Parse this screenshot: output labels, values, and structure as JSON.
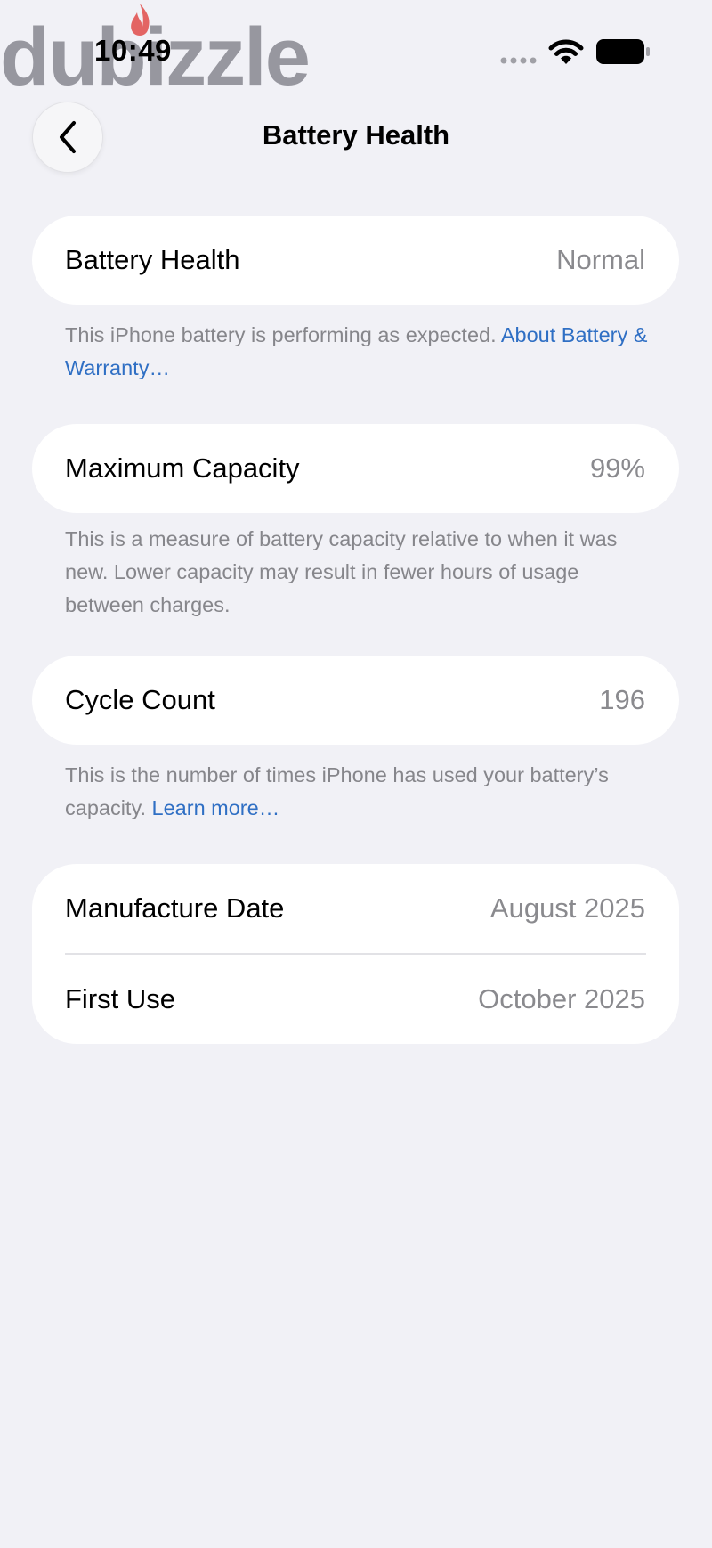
{
  "status_bar": {
    "time": "10:49",
    "watermark": "dubizzle",
    "icons": [
      "cellular-dots-icon",
      "wifi-icon",
      "battery-icon"
    ]
  },
  "nav": {
    "title": "Battery Health",
    "back_icon": "chevron-left-icon"
  },
  "sections": {
    "health": {
      "label": "Battery Health",
      "value": "Normal",
      "footnote": "This iPhone battery is performing as expected.",
      "link": "About Battery & Warranty…"
    },
    "capacity": {
      "label": "Maximum Capacity",
      "value": "99%",
      "footnote": "This is a measure of battery capacity relative to when it was new. Lower capacity may result in fewer hours of usage between charges."
    },
    "cycles": {
      "label": "Cycle Count",
      "value": "196",
      "footnote": "This is the number of times iPhone has used your battery’s capacity.",
      "link": "Learn more…"
    },
    "dates": {
      "manufacture_label": "Manufacture Date",
      "manufacture_value": "August 2025",
      "first_use_label": "First Use",
      "first_use_value": "October 2025"
    }
  },
  "colors": {
    "background": "#f1f1f6",
    "card": "#ffffff",
    "secondary_text": "#8a8a8e",
    "link": "#2f6fc4",
    "watermark_flame": "#e0413f"
  }
}
